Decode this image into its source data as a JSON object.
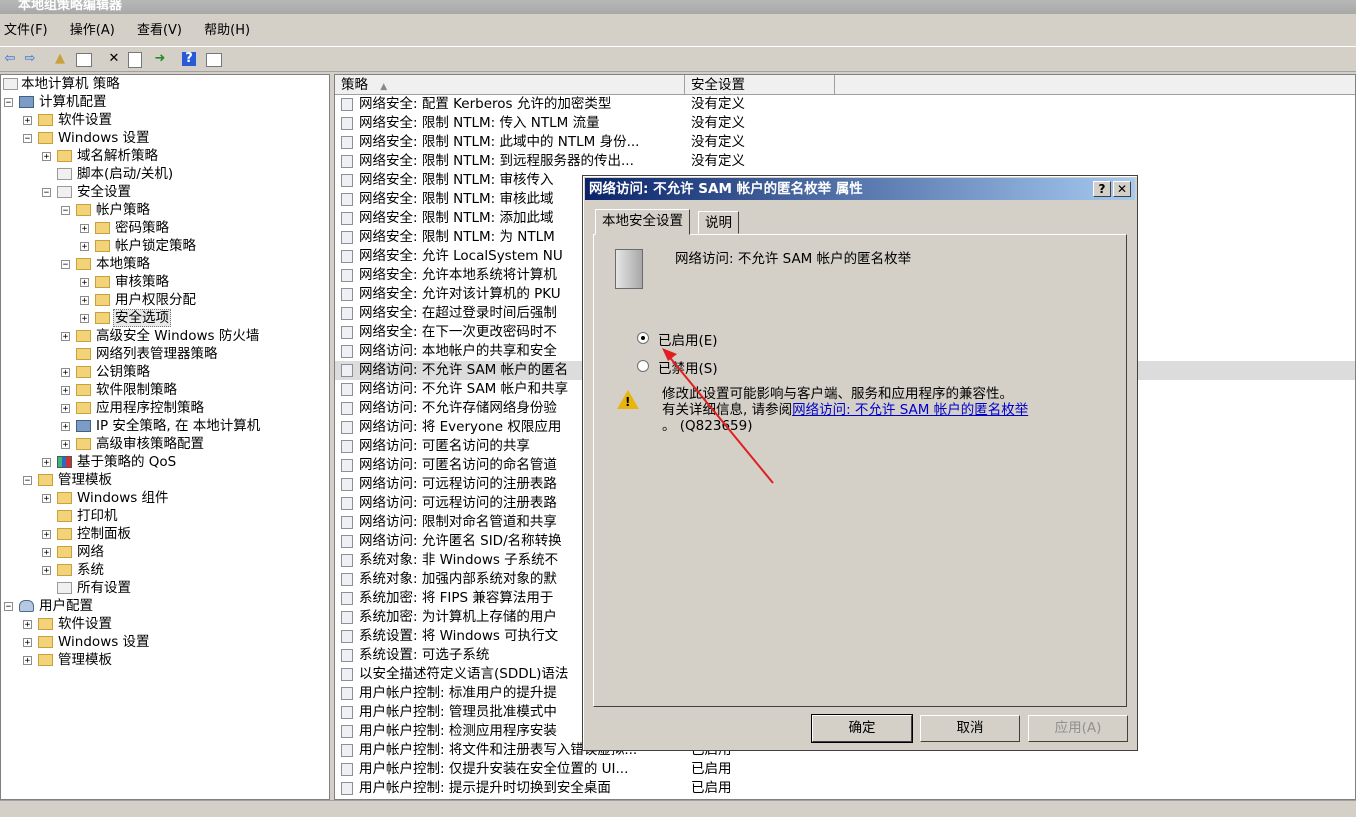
{
  "window": {
    "title": "本地组策略编辑器"
  },
  "menu": [
    "文件(F)",
    "操作(A)",
    "查看(V)",
    "帮助(H)"
  ],
  "toolbar": {
    "icons": [
      "back-icon",
      "forward-icon",
      "up-folder-icon",
      "show-hide-tree-icon",
      "delete-icon",
      "properties-icon",
      "export-icon",
      "help-icon",
      "view-icon"
    ]
  },
  "tree": {
    "root": "本地计算机 策略",
    "items": [
      {
        "label": "计算机配置"
      },
      {
        "label": "软件设置"
      },
      {
        "label": "Windows 设置"
      },
      {
        "label": "域名解析策略"
      },
      {
        "label": "脚本(启动/关机)"
      },
      {
        "label": "安全设置"
      },
      {
        "label": "帐户策略"
      },
      {
        "label": "密码策略"
      },
      {
        "label": "帐户锁定策略"
      },
      {
        "label": "本地策略"
      },
      {
        "label": "审核策略"
      },
      {
        "label": "用户权限分配"
      },
      {
        "label": "安全选项"
      },
      {
        "label": "高级安全 Windows 防火墙"
      },
      {
        "label": "网络列表管理器策略"
      },
      {
        "label": "公钥策略"
      },
      {
        "label": "软件限制策略"
      },
      {
        "label": "应用程序控制策略"
      },
      {
        "label": "IP 安全策略, 在 本地计算机"
      },
      {
        "label": "高级审核策略配置"
      },
      {
        "label": "基于策略的 QoS"
      },
      {
        "label": "管理模板"
      },
      {
        "label": "Windows 组件"
      },
      {
        "label": "打印机"
      },
      {
        "label": "控制面板"
      },
      {
        "label": "网络"
      },
      {
        "label": "系统"
      },
      {
        "label": "所有设置"
      },
      {
        "label": "用户配置"
      },
      {
        "label": "软件设置"
      },
      {
        "label": "Windows 设置"
      },
      {
        "label": "管理模板"
      }
    ]
  },
  "list": {
    "columns": [
      "策略",
      "安全设置"
    ],
    "rows": [
      {
        "name": "网络安全: 配置 Kerberos 允许的加密类型",
        "value": "没有定义"
      },
      {
        "name": "网络安全: 限制 NTLM: 传入 NTLM 流量",
        "value": "没有定义"
      },
      {
        "name": "网络安全: 限制 NTLM: 此域中的 NTLM 身份...",
        "value": "没有定义"
      },
      {
        "name": "网络安全: 限制 NTLM: 到远程服务器的传出...",
        "value": "没有定义"
      },
      {
        "name": "网络安全: 限制 NTLM: 审核传入",
        "value": ""
      },
      {
        "name": "网络安全: 限制 NTLM: 审核此域",
        "value": ""
      },
      {
        "name": "网络安全: 限制 NTLM: 添加此域",
        "value": ""
      },
      {
        "name": "网络安全: 限制 NTLM: 为 NTLM",
        "value": ""
      },
      {
        "name": "网络安全: 允许 LocalSystem NU",
        "value": ""
      },
      {
        "name": "网络安全: 允许本地系统将计算机",
        "value": ""
      },
      {
        "name": "网络安全: 允许对该计算机的 PKU",
        "value": ""
      },
      {
        "name": "网络安全: 在超过登录时间后强制",
        "value": ""
      },
      {
        "name": "网络安全: 在下一次更改密码时不",
        "value": ""
      },
      {
        "name": "网络访问: 本地帐户的共享和安全",
        "value": ""
      },
      {
        "name": "网络访问: 不允许 SAM 帐户的匿名",
        "value": ""
      },
      {
        "name": "网络访问: 不允许 SAM 帐户和共享",
        "value": ""
      },
      {
        "name": "网络访问: 不允许存储网络身份验",
        "value": ""
      },
      {
        "name": "网络访问: 将 Everyone 权限应用",
        "value": ""
      },
      {
        "name": "网络访问: 可匿名访问的共享",
        "value": ""
      },
      {
        "name": "网络访问: 可匿名访问的命名管道",
        "value": ""
      },
      {
        "name": "网络访问: 可远程访问的注册表路",
        "value": ""
      },
      {
        "name": "网络访问: 可远程访问的注册表路",
        "value": ""
      },
      {
        "name": "网络访问: 限制对命名管道和共享",
        "value": ""
      },
      {
        "name": "网络访问: 允许匿名 SID/名称转换",
        "value": ""
      },
      {
        "name": "系统对象: 非 Windows 子系统不",
        "value": ""
      },
      {
        "name": "系统对象: 加强内部系统对象的默",
        "value": ""
      },
      {
        "name": "系统加密: 将 FIPS 兼容算法用于",
        "value": ""
      },
      {
        "name": "系统加密: 为计算机上存储的用户",
        "value": ""
      },
      {
        "name": "系统设置: 将 Windows 可执行文",
        "value": ""
      },
      {
        "name": "系统设置: 可选子系统",
        "value": ""
      },
      {
        "name": "以安全描述符定义语言(SDDL)语法",
        "value": ""
      },
      {
        "name": "用户帐户控制: 标准用户的提升提",
        "value": ""
      },
      {
        "name": "用户帐户控制: 管理员批准模式中",
        "value": ""
      },
      {
        "name": "用户帐户控制: 检测应用程序安装",
        "value": ""
      },
      {
        "name": "用户帐户控制: 将文件和注册表写入错误虚拟...",
        "value": "已启用"
      },
      {
        "name": "用户帐户控制: 仅提升安装在安全位置的 UI...",
        "value": "已启用"
      },
      {
        "name": "用户帐户控制: 提示提升时切换到安全桌面",
        "value": "已启用"
      }
    ]
  },
  "dialog": {
    "title": "网络访问: 不允许 SAM 帐户的匿名枚举 属性",
    "help_btn": "?",
    "close_btn": "✕",
    "tabs": [
      "本地安全设置",
      "说明"
    ],
    "policy_name": "网络访问: 不允许 SAM 帐户的匿名枚举",
    "option_enabled": "已启用(E)",
    "option_disabled": "已禁用(S)",
    "selected": "enabled",
    "warning_line1": "修改此设置可能影响与客户端、服务和应用程序的兼容性。",
    "warning_line2_prefix": "有关详细信息, 请参阅",
    "warning_link": "网络访问: 不允许 SAM 帐户的匿名枚举",
    "warning_line3": "。 (Q823659)",
    "buttons": {
      "ok": "确定",
      "cancel": "取消",
      "apply": "应用(A)"
    }
  },
  "colors": {
    "annotation_arrow": "#e02020",
    "dialog_title_start": "#0a246a",
    "dialog_title_end": "#a6caf0",
    "link": "#0000cc"
  }
}
